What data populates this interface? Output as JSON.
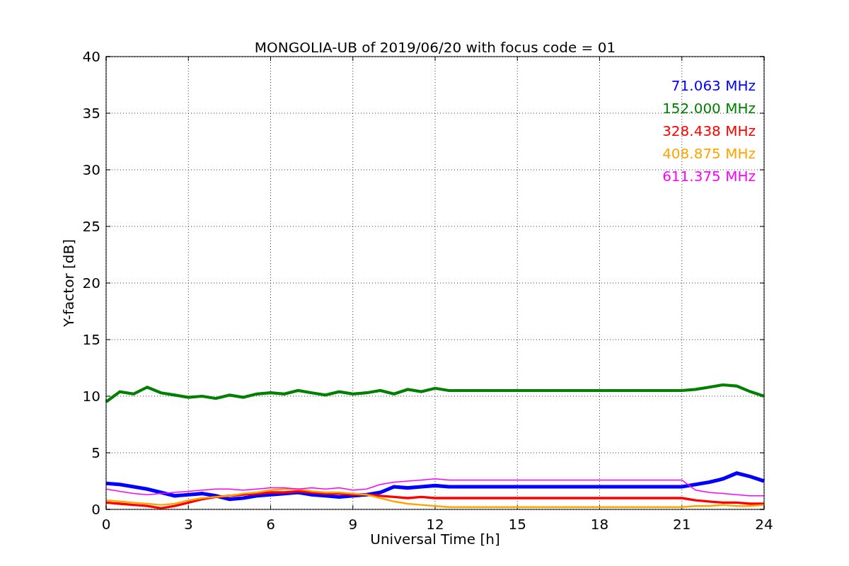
{
  "chart_data": {
    "type": "line",
    "title": "MONGOLIA-UB of 2019/06/20 with focus code = 01",
    "xlabel": "Universal Time [h]",
    "ylabel": "Y-factor [dB]",
    "x": [
      0,
      0.5,
      1,
      1.5,
      2,
      2.5,
      3,
      3.5,
      4,
      4.5,
      5,
      5.5,
      6,
      6.5,
      7,
      7.5,
      8,
      8.5,
      9,
      9.5,
      10,
      10.5,
      11,
      11.5,
      12,
      12.5,
      21,
      21.5,
      22,
      22.5,
      23,
      23.5,
      24
    ],
    "series": [
      {
        "name": "71.063 MHz",
        "color": "#0000ff",
        "values": [
          2.3,
          2.2,
          2.0,
          1.8,
          1.5,
          1.2,
          1.3,
          1.4,
          1.2,
          0.9,
          1.0,
          1.2,
          1.3,
          1.4,
          1.5,
          1.3,
          1.2,
          1.1,
          1.2,
          1.3,
          1.5,
          2.0,
          1.9,
          2.0,
          2.1,
          2.0,
          2.0,
          2.2,
          2.4,
          2.7,
          3.2,
          2.9,
          2.5
        ]
      },
      {
        "name": "152.000 MHz",
        "color": "#008000",
        "values": [
          9.5,
          10.4,
          10.2,
          10.8,
          10.3,
          10.1,
          9.9,
          10.0,
          9.8,
          10.1,
          9.9,
          10.2,
          10.3,
          10.2,
          10.5,
          10.3,
          10.1,
          10.4,
          10.2,
          10.3,
          10.5,
          10.2,
          10.6,
          10.4,
          10.7,
          10.5,
          10.5,
          10.6,
          10.8,
          11.0,
          10.9,
          10.4,
          10.0
        ]
      },
      {
        "name": "328.438 MHz",
        "color": "#ff0000",
        "values": [
          0.6,
          0.5,
          0.4,
          0.3,
          0.1,
          0.3,
          0.6,
          0.9,
          1.1,
          1.2,
          1.3,
          1.4,
          1.5,
          1.5,
          1.6,
          1.5,
          1.4,
          1.4,
          1.3,
          1.3,
          1.2,
          1.1,
          1.0,
          1.1,
          1.0,
          1.0,
          1.0,
          0.8,
          0.7,
          0.6,
          0.6,
          0.5,
          0.5
        ]
      },
      {
        "name": "408.875 MHz",
        "color": "#ffa500",
        "values": [
          0.8,
          0.7,
          0.6,
          0.5,
          0.4,
          0.5,
          0.8,
          1.0,
          1.1,
          1.2,
          1.4,
          1.5,
          1.7,
          1.8,
          1.8,
          1.6,
          1.5,
          1.5,
          1.4,
          1.3,
          1.0,
          0.7,
          0.5,
          0.4,
          0.3,
          0.2,
          0.2,
          0.3,
          0.3,
          0.4,
          0.3,
          0.3,
          0.4
        ]
      },
      {
        "name": "611.375 MHz",
        "color": "#ff00ff",
        "values": [
          1.8,
          1.6,
          1.4,
          1.3,
          1.4,
          1.5,
          1.6,
          1.7,
          1.8,
          1.8,
          1.7,
          1.8,
          1.9,
          1.9,
          1.8,
          1.9,
          1.8,
          1.9,
          1.7,
          1.8,
          2.2,
          2.4,
          2.5,
          2.6,
          2.7,
          2.6,
          2.6,
          1.7,
          1.5,
          1.4,
          1.3,
          1.2,
          1.2
        ]
      }
    ],
    "xlim": [
      0,
      24
    ],
    "ylim": [
      0,
      40
    ],
    "xticks": [
      0,
      3,
      6,
      9,
      12,
      15,
      18,
      21,
      24
    ],
    "yticks": [
      0,
      5,
      10,
      15,
      20,
      25,
      30,
      35,
      40
    ],
    "grid": true
  }
}
